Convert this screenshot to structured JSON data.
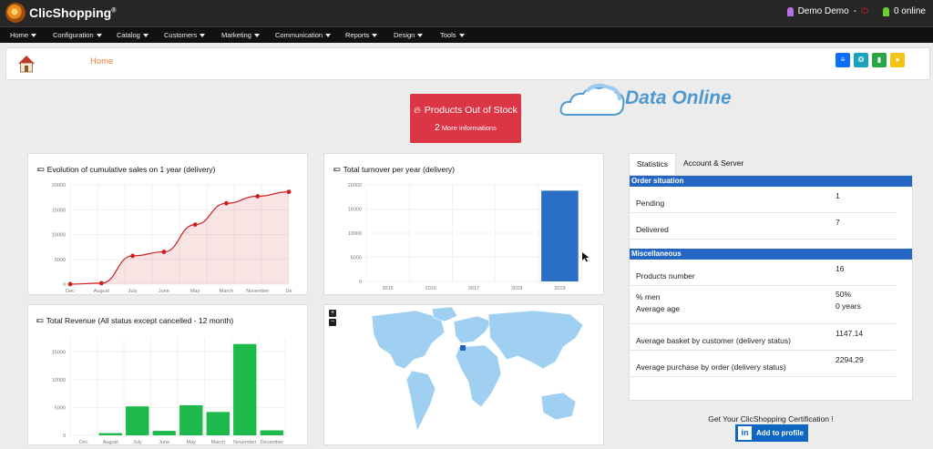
{
  "app": {
    "name": "ClicShopping",
    "trademark": "®"
  },
  "user": {
    "name": "Demo Demo",
    "separator": "-",
    "online_label": "0 online"
  },
  "menu": [
    {
      "label": "Home"
    },
    {
      "label": "Configuration"
    },
    {
      "label": "Catalog"
    },
    {
      "label": "Customers"
    },
    {
      "label": "Marketing"
    },
    {
      "label": "Communication"
    },
    {
      "label": "Reports"
    },
    {
      "label": "Design"
    },
    {
      "label": "Tools"
    }
  ],
  "breadcrumb": {
    "home": "Home"
  },
  "header_buttons": [
    {
      "icon": "list-icon",
      "color": "#0d6efd",
      "glyph": "≡"
    },
    {
      "icon": "info-icon",
      "color": "#1aa2bd",
      "glyph": "❂"
    },
    {
      "icon": "bookmark-icon",
      "color": "#27a844",
      "glyph": "▮"
    },
    {
      "icon": "user-icon",
      "color": "#f2c40f",
      "glyph": "●"
    }
  ],
  "stock_alert": {
    "title": "Products Out of Stock",
    "count": "2",
    "more": "More informations"
  },
  "data_online": {
    "text": "Data Online"
  },
  "charts": [
    {
      "title": "Evolution of cumulative sales on 1 year (delivery)",
      "chart_data": {
        "type": "area",
        "categories": [
          "Dec",
          "August",
          "July",
          "June",
          "May",
          "March",
          "November",
          "De"
        ],
        "values": [
          0,
          200,
          5700,
          6500,
          12000,
          16300,
          17700,
          18600
        ],
        "ylim": [
          0,
          20000
        ],
        "yticks": [
          "20000",
          "15000",
          "10000",
          "5000",
          "0"
        ],
        "color": "#cc1f1f"
      }
    },
    {
      "title": "Total turnover per year (delivery)",
      "chart_data": {
        "type": "bar",
        "categories": [
          "2015",
          "2016",
          "2017",
          "2018",
          "2019"
        ],
        "values": [
          0,
          0,
          0,
          0,
          18800
        ],
        "ylim": [
          0,
          20000
        ],
        "yticks": [
          "20000",
          "15000",
          "10000",
          "5000",
          "0"
        ],
        "color": "#2a6ec6"
      }
    },
    {
      "title": "Total Revenue (All status except cancelled - 12 month)",
      "chart_data": {
        "type": "bar",
        "categories": [
          "Dec",
          "August",
          "July",
          "June",
          "May",
          "March",
          "November",
          "December"
        ],
        "values": [
          0,
          400,
          5200,
          800,
          5400,
          4200,
          16400,
          900
        ],
        "ylim": [
          0,
          17500
        ],
        "yticks": [
          "15000",
          "10000",
          "5000",
          "0"
        ],
        "color": "#1db94a"
      }
    }
  ],
  "map": {
    "zoom_in": "+",
    "zoom_out": "−",
    "land_color": "#9fd0f2",
    "highlight_color": "#1f5fbf"
  },
  "stats": {
    "tabs": [
      "Statistics",
      "Account & Server"
    ],
    "order_heading": "Order situation",
    "order_rows": [
      {
        "label": "Pending",
        "value": "1"
      },
      {
        "label": "Delivered",
        "value": "7"
      }
    ],
    "misc_heading": "Miscellaneous",
    "products_row": {
      "label": "Products number",
      "value": "16"
    },
    "men_row": {
      "label1": "% men",
      "label2": "Average age",
      "value1": "50%",
      "value2": "0 years"
    },
    "misc_rows": [
      {
        "label": "Average basket by customer (delivery status)",
        "value": "1147.14"
      },
      {
        "label": "Average purchase by order (delivery status)",
        "value": "2294.29"
      }
    ]
  },
  "certification": {
    "text": "Get Your ClicShopping Certification !",
    "button": "Add to profile",
    "badge": "in"
  }
}
